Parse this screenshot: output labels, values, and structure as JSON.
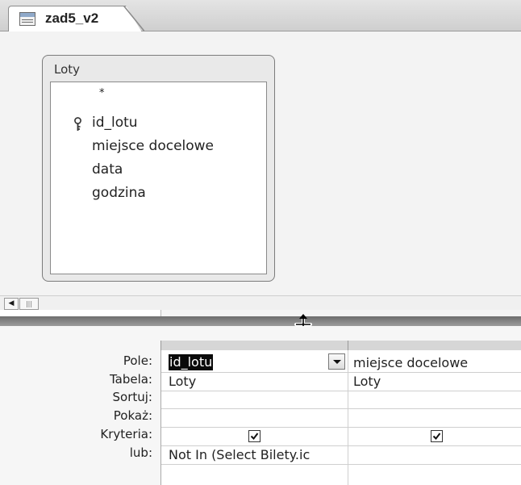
{
  "window": {
    "tab_title": "zad5_v2",
    "tab_icon": "query-design-icon"
  },
  "table_box": {
    "title": "Loty",
    "fields": [
      "*",
      "id_lotu",
      "miejsce docelowe",
      "data",
      "godzina"
    ],
    "primary_key_field": "id_lotu"
  },
  "grid": {
    "row_labels": {
      "pole": "Pole:",
      "tabela": "Tabela:",
      "sortuj": "Sortuj:",
      "pokaz": "Pokaż:",
      "kryteria": "Kryteria:",
      "lub": "lub:"
    },
    "columns": [
      {
        "field": "id_lotu",
        "table": "Loty",
        "sort": "",
        "show": true,
        "criteria": "Not In (Select Bilety.ic",
        "or": ""
      },
      {
        "field": "miejsce docelowe",
        "table": "Loty",
        "sort": "",
        "show": true,
        "criteria": "",
        "or": ""
      }
    ]
  }
}
